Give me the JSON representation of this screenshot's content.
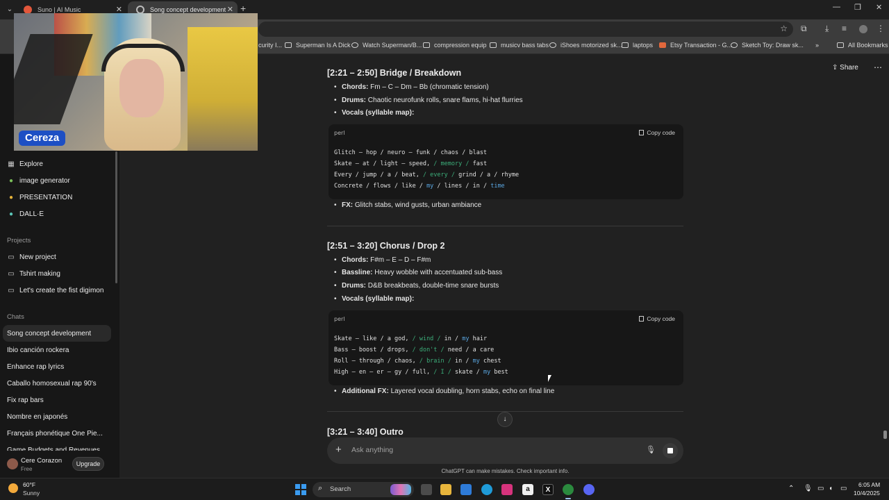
{
  "browser": {
    "tabs": [
      {
        "label": "Suno | AI Music",
        "close": "✕"
      },
      {
        "label": "Song concept development",
        "close": "✕"
      }
    ],
    "new_tab": "+",
    "window_controls": {
      "minimize": "—",
      "maximize": "❐",
      "close": "✕"
    },
    "bookmarks": [
      {
        "label": "curity I...",
        "icon": "page-icon"
      },
      {
        "label": "Superman Is A Dick",
        "icon": "page-icon"
      },
      {
        "label": "Watch Superman/B...",
        "icon": "globe-icon"
      },
      {
        "label": "compression equip",
        "icon": "folder-icon"
      },
      {
        "label": "musicv bass tabs",
        "icon": "folder-icon"
      },
      {
        "label": "iShoes motorized sk...",
        "icon": "globe-icon"
      },
      {
        "label": "laptops",
        "icon": "folder-icon"
      },
      {
        "label": "Etsy Transaction - G...",
        "icon": "etsy-icon"
      },
      {
        "label": "Sketch Toy: Draw sk...",
        "icon": "globe-icon"
      },
      {
        "label": "All Bookmarks",
        "icon": "folder-icon"
      }
    ],
    "bookmarks_overflow": "»"
  },
  "webcam": {
    "name_tag": "Cereza"
  },
  "sidebar": {
    "gpts": [
      {
        "label": "Explore",
        "icon": "grid-icon"
      },
      {
        "label": "image generator",
        "icon": "gpt-avatar-icon"
      },
      {
        "label": "PRESENTATION",
        "icon": "gpt-avatar-icon"
      },
      {
        "label": "DALL·E",
        "icon": "gpt-avatar-icon"
      }
    ],
    "projects_heading": "Projects",
    "projects": [
      {
        "label": "New project",
        "icon": "folder-plus-icon"
      },
      {
        "label": "Tshirt making",
        "icon": "folder-icon"
      },
      {
        "label": "Let's create the fist digimon",
        "icon": "folder-icon"
      }
    ],
    "chats_heading": "Chats",
    "chats": [
      "Song concept development",
      "Ibio canción rockera",
      "Enhance rap lyrics",
      "Caballo homosexual rap 90's",
      "Fix rap bars",
      "Nombre en japonés",
      "Français phonétique One Pie...",
      "Game Budgets and Revenues"
    ],
    "user": {
      "name": "Cere Corazon",
      "plan": "Free",
      "upgrade": "Upgrade"
    }
  },
  "header": {
    "share": "Share",
    "more": "⋯"
  },
  "content": {
    "bridge": {
      "title": "[2:21 – 2:50] Bridge / Breakdown",
      "chords_label": "Chords:",
      "chords": "Fm – C – Dm – Bb (chromatic tension)",
      "drums_label": "Drums:",
      "drums": "Chaotic neurofunk rolls, snare flams, hi-hat flurries",
      "vocals_label": "Vocals (syllable map):",
      "code": {
        "lang": "perl",
        "copy": "Copy code",
        "lines": [
          {
            "a": "Glitch – hop / neuro – funk / chaos / blast",
            "g": "",
            "b": "",
            "c": ""
          },
          {
            "a": "Skate – at / light – speed, ",
            "g": "/ memory /",
            "b": "",
            "c": " fast"
          },
          {
            "a": "Every / jump / a / beat, ",
            "g": "/ every /",
            "b": "",
            "c": " grind / a / rhyme"
          },
          {
            "a": "Concrete / flows / like / ",
            "g": "",
            "b": "my",
            "c": " / lines / in / ",
            "d": "time"
          }
        ]
      },
      "fx_label": "FX:",
      "fx": "Glitch stabs, wind gusts, urban ambiance"
    },
    "chorus": {
      "title": "[2:51 – 3:20] Chorus / Drop 2",
      "chords_label": "Chords:",
      "chords": "F#m – E – D – F#m",
      "bass_label": "Bassline:",
      "bass": "Heavy wobble with accentuated sub-bass",
      "drums_label": "Drums:",
      "drums": "D&B breakbeats, double-time snare bursts",
      "vocals_label": "Vocals (syllable map):",
      "code": {
        "lang": "perl",
        "copy": "Copy code",
        "lines": [
          {
            "a": "Skate – like / a god, ",
            "g": "/ wind /",
            "m": " in / ",
            "b": "my",
            "c": " hair"
          },
          {
            "a": "Bass – boost / drops, ",
            "g": "/ don't /",
            "m": " need / a care",
            "b": "",
            "c": ""
          },
          {
            "a": "Roll – through / chaos, ",
            "g": "/ brain /",
            "m": " in / ",
            "b": "my",
            "c": " chest"
          },
          {
            "a": "High – en – er – gy / full, ",
            "g": "/ I /",
            "m": " skate / ",
            "b": "my",
            "c": " best"
          }
        ]
      },
      "fx_label": "Additional FX:",
      "fx": "Layered vocal doubling, horn stabs, echo on final line"
    },
    "outro": {
      "title": "[3:21 – 3:40] Outro"
    }
  },
  "composer": {
    "placeholder": "Ask anything",
    "disclaimer": "ChatGPT can make mistakes. Check important info."
  },
  "taskbar": {
    "temperature": "60°F",
    "condition": "Sunny",
    "search": "Search",
    "time": "6:05 AM",
    "date": "10/4/2025"
  }
}
